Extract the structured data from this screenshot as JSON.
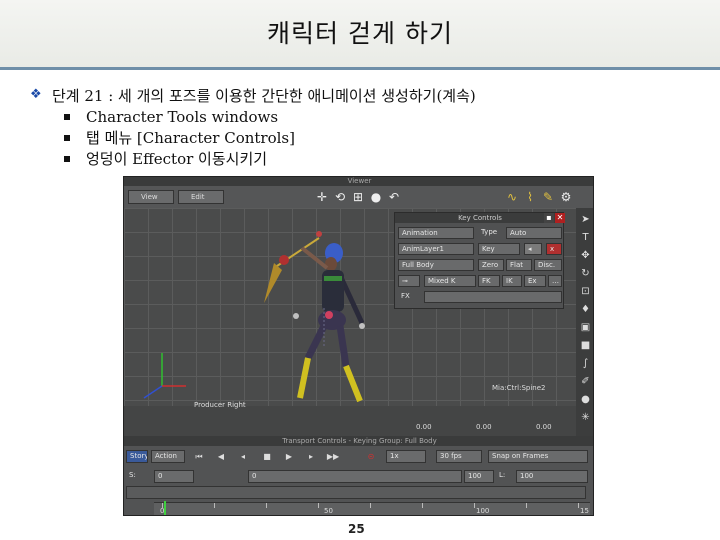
{
  "slide": {
    "title": "캐릭터 걷게 하기",
    "bullet": "단계 21 : 세 개의 포즈를 이용한 간단한 애니메이션 생성하기(계속)",
    "sub_items": [
      "Character Tools windows",
      "탭 메뉴 [Character Controls]",
      "엉덩이 Effector 이동시키기"
    ],
    "page_number": "25"
  },
  "viewer": {
    "title": "Viewer",
    "menu1": "View",
    "menu2": "Edit",
    "kc": {
      "title": "Key Controls",
      "r1a": "Animation",
      "r1b": "Type",
      "r1c": "Auto",
      "r2a": "AnimLayer1",
      "r2b": "Key",
      "r2c": "x",
      "r3a": "Full Body",
      "r3b": "Zero",
      "r3c": "Flat",
      "r3d": "Disc.",
      "r4a": "Mixed K",
      "r4b": "FK",
      "r4c": "IK",
      "r4d": "Ex",
      "r5a": "FX"
    },
    "bottom_label": "Producer Right",
    "bottom_right_label": "Mia:Ctrl:Spine2",
    "coords": [
      "0.00",
      "0.00",
      "0.00"
    ]
  },
  "transport": {
    "title": "Transport Controls - Keying Group: Full Body",
    "story": "Story",
    "action": "Action",
    "speed": "1x",
    "fps": "30 fps",
    "snap": "Snap on Frames",
    "s_label": "S:",
    "s_val": "0",
    "e_val": "100",
    "l_label": "L:",
    "l_val": "100",
    "current": "0",
    "ruler": [
      "0",
      "50",
      "100",
      "15"
    ]
  }
}
